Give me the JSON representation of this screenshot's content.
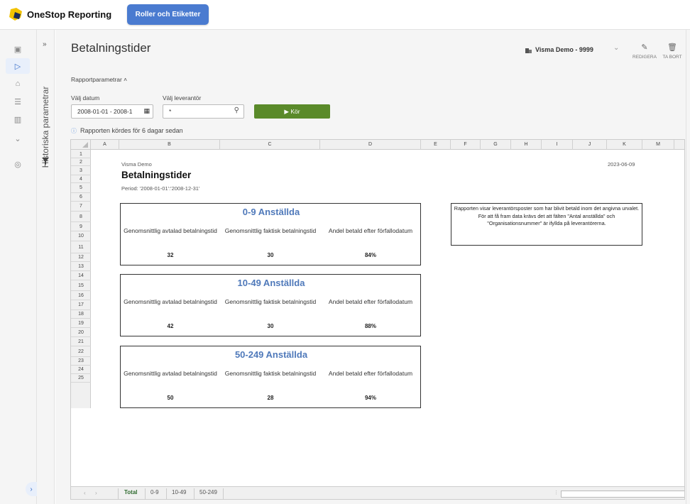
{
  "app": {
    "brand": "OneStop Reporting",
    "pill_button": "Roller och Etiketter",
    "history_panel_label": "Historiska parametrar"
  },
  "nav_icons": [
    "dashboard-icon",
    "play-icon",
    "lock-icon",
    "checklist-icon",
    "library-icon",
    "chevron-down-icon",
    "settings-icon"
  ],
  "header": {
    "title": "Betalningstider",
    "company": "Visma Demo - 9999",
    "edit_label": "REDIGERA",
    "delete_label": "TA BORT"
  },
  "params": {
    "section_label": "Rapportparametrar ˄",
    "date_label": "Välj datum",
    "date_value": "2008-01-01 - 2008-1",
    "supplier_label": "Välj leverantör",
    "supplier_value": "*",
    "run_label": "▶ Kör",
    "run_info": "Rapporten kördes för 6 dagar sedan"
  },
  "sheet": {
    "columns": [
      "A",
      "B",
      "C",
      "D",
      "E",
      "F",
      "G",
      "H",
      "I",
      "J",
      "K",
      "M"
    ],
    "rows": [
      "1",
      "2",
      "3",
      "4",
      "5",
      "6",
      "7",
      "8",
      "9",
      "10",
      "11",
      "12",
      "13",
      "14",
      "15",
      "16",
      "17",
      "18",
      "19",
      "20",
      "21",
      "22",
      "23",
      "24",
      "25"
    ],
    "company": "Visma Demo",
    "date": "2023-06-09",
    "title": "Betalningstider",
    "period": "Period: '2008-01-01':'2008-12-31'",
    "metric_labels": [
      "Genomsnittlig avtalad betalningstid",
      "Genomsnittlig faktisk betalningstid",
      "Andel betald efter förfallodatum"
    ],
    "groups": [
      {
        "title": "0-9 Anställda",
        "values": [
          "32",
          "30",
          "84%"
        ]
      },
      {
        "title": "10-49 Anställda",
        "values": [
          "42",
          "30",
          "88%"
        ]
      },
      {
        "title": "50-249 Anställda",
        "values": [
          "50",
          "28",
          "94%"
        ]
      }
    ],
    "note": "Rapporten visar leverantörsposter som har blivit betald inom det angivna urvalet. För att få fram data krävs det att fälten \"Antal anställda\" och \"Organisationsnummer\" är ifyllda på leverantörerna.",
    "tabs": [
      "Total",
      "0-9",
      "10-49",
      "50-249"
    ],
    "active_tab": "Total"
  },
  "colors": {
    "accent": "#4a7bd0",
    "run": "#5a8a2a",
    "group_title": "#4f79ba"
  }
}
